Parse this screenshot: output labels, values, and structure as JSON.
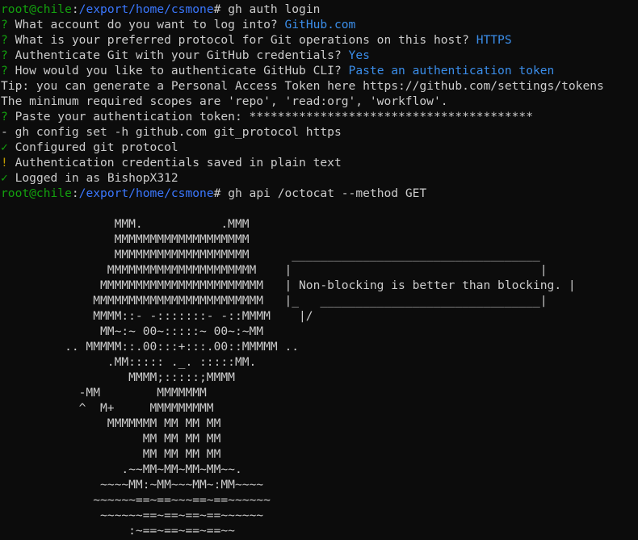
{
  "prompt": {
    "user_host": "root@chile",
    "path": "/export/home/csmone",
    "symbol": "#"
  },
  "commands": {
    "auth_login": " gh auth login",
    "api_octocat": " gh api /octocat --method GET"
  },
  "auth": {
    "q1": {
      "mark": "?",
      "text": " What account do you want to log into? ",
      "answer": "GitHub.com"
    },
    "q2": {
      "mark": "?",
      "text": " What is your preferred protocol for Git operations on this host? ",
      "answer": "HTTPS"
    },
    "q3": {
      "mark": "?",
      "text": " Authenticate Git with your GitHub credentials? ",
      "answer": "Yes"
    },
    "q4": {
      "mark": "?",
      "text": " How would you like to authenticate GitHub CLI? ",
      "answer": "Paste an authentication token"
    },
    "tip": "Tip: you can generate a Personal Access Token here https://github.com/settings/tokens",
    "scopes": "The minimum required scopes are 'repo', 'read:org', 'workflow'.",
    "q5": {
      "mark": "?",
      "text": " Paste your authentication token: ",
      "answer": "****************************************"
    },
    "config_cmd": "- gh config set -h github.com git_protocol https",
    "configured": {
      "mark": "✓",
      "text": " Configured git protocol"
    },
    "warning": {
      "mark": "!",
      "text": " Authentication credentials saved in plain text"
    },
    "logged_in": {
      "mark": "✓",
      "text": " Logged in as ",
      "user": "BishopX312"
    }
  },
  "octocat_art": "                MMM.           .MMM\n                MMMMMMMMMMMMMMMMMMM\n                MMMMMMMMMMMMMMMMMMM      ___________________________________\n               MMMMMMMMMMMMMMMMMMMMM    |                                   |\n              MMMMMMMMMMMMMMMMMMMMMMM   | Non-blocking is better than blocking. |\n             MMMMMMMMMMMMMMMMMMMMMMMM   |_   _______________________________|\n             MMMM::- -:::::::- -::MMMM    |/\n              MM~:~ 00~:::::~ 00~:~MM\n         .. MMMMM::.00:::+:::.00::MMMMM ..\n               .MM::::: ._. :::::MM.\n                  MMMM;:::::;MMMM\n           -MM        MMMMMMM\n           ^  M+     MMMMMMMMM\n               MMMMMMM MM MM MM\n                    MM MM MM MM\n                    MM MM MM MM\n                 .~~MM~MM~MM~MM~~.\n              ~~~~MM:~MM~~~MM~:MM~~~~\n             ~~~~~~==~==~~~==~==~~~~~~\n              ~~~~~~==~==~==~==~~~~~~\n                  :~==~==~==~==~~"
}
